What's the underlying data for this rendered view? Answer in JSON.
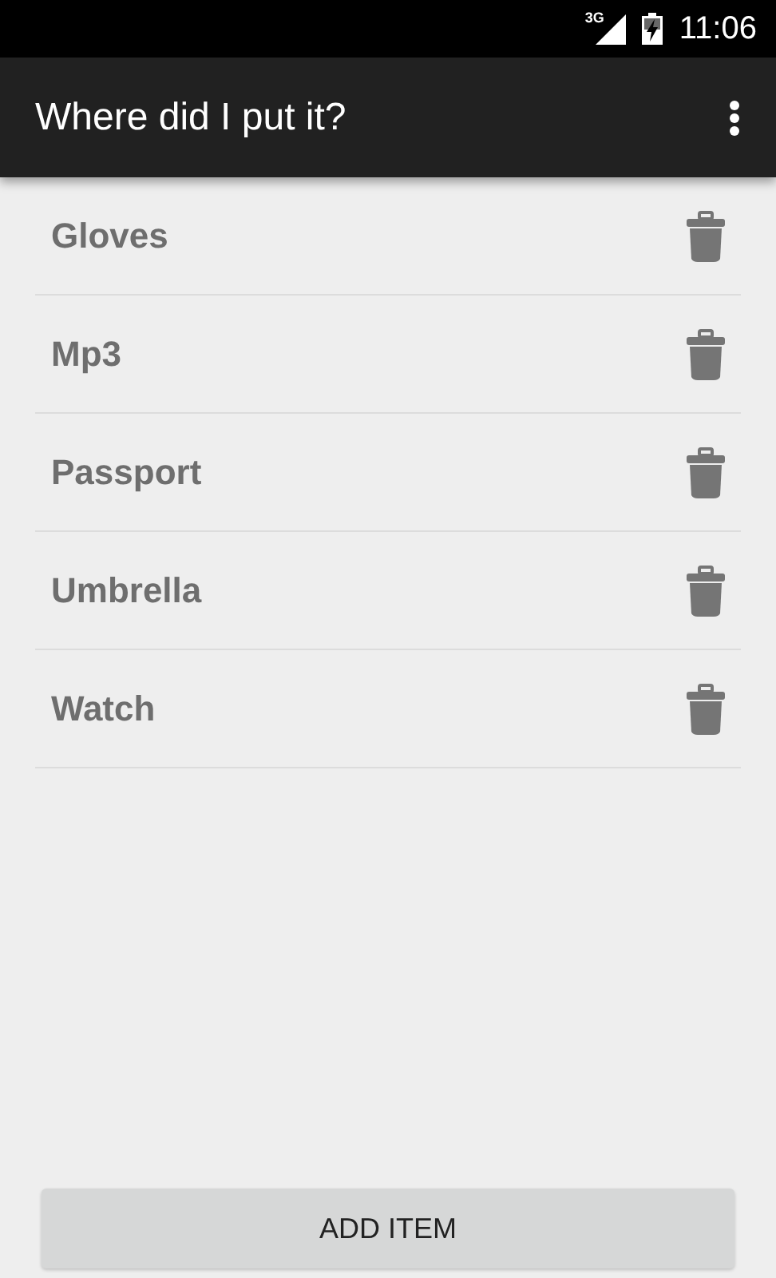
{
  "status_bar": {
    "network": "3G",
    "time": "11:06"
  },
  "app_bar": {
    "title": "Where did I put it?"
  },
  "items": [
    {
      "label": "Gloves"
    },
    {
      "label": "Mp3"
    },
    {
      "label": "Passport"
    },
    {
      "label": "Umbrella"
    },
    {
      "label": "Watch"
    }
  ],
  "button": {
    "label": "ADD ITEM"
  }
}
